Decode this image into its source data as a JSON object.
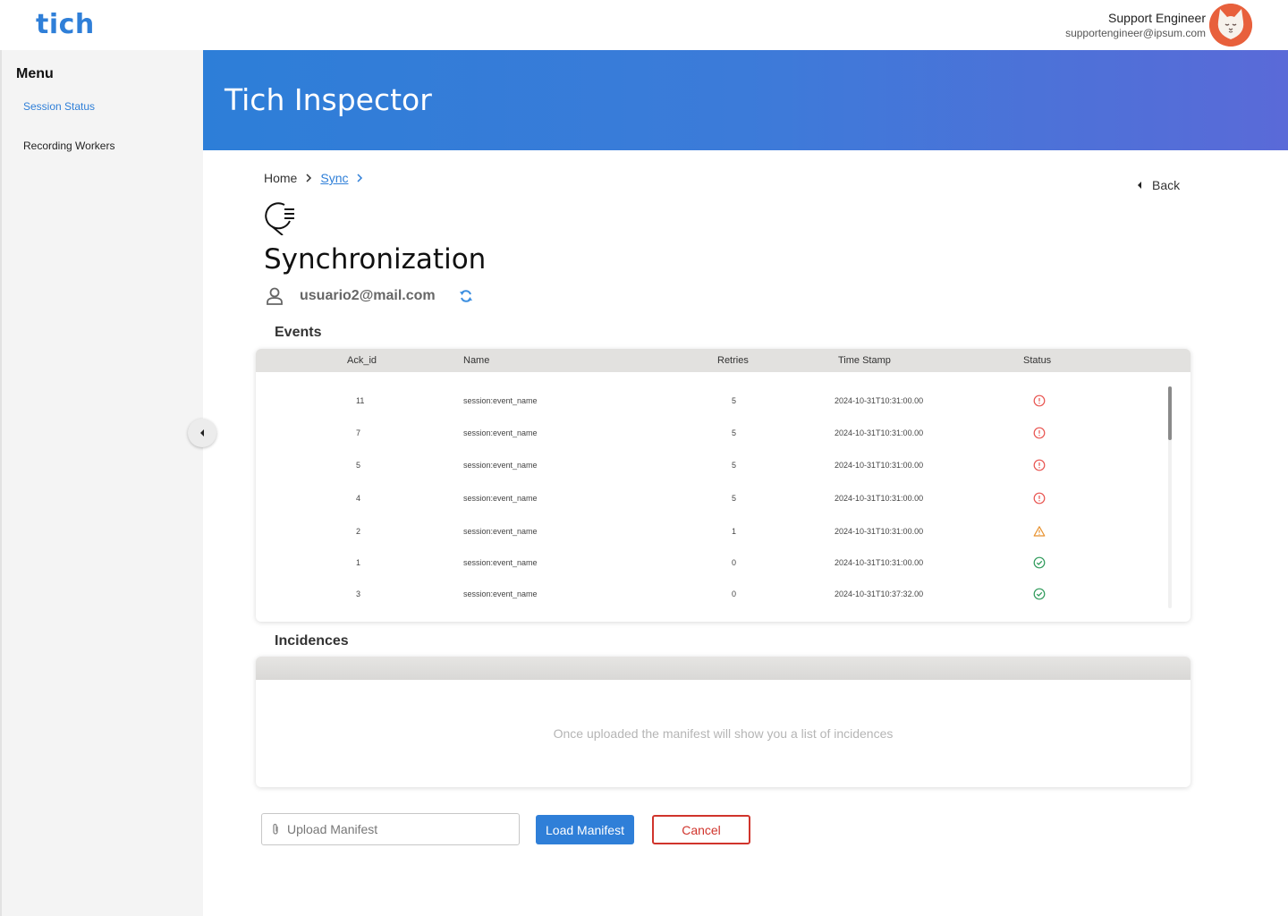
{
  "app": {
    "logo": "tich",
    "banner_title": "Tich Inspector"
  },
  "user": {
    "name": "Support Engineer",
    "email": "supportengineer@ipsum.com",
    "avatar_icon": "cat-avatar-icon"
  },
  "sidebar": {
    "title": "Menu",
    "items": [
      {
        "label": "Session Status",
        "active": true
      },
      {
        "label": "Recording Workers",
        "active": false
      }
    ]
  },
  "breadcrumb": {
    "home": "Home",
    "sync": "Sync"
  },
  "back_label": "Back",
  "page": {
    "title": "Synchronization",
    "user_email": "usuario2@mail.com"
  },
  "events": {
    "title": "Events",
    "columns": [
      "Ack_id",
      "Name",
      "Retries",
      "Time Stamp",
      "Status"
    ],
    "rows": [
      {
        "ack_id": "11",
        "name": "session:event_name",
        "retries": "5",
        "timestamp": "2024-10-31T10:31:00.00",
        "status": "error"
      },
      {
        "ack_id": "7",
        "name": "session:event_name",
        "retries": "5",
        "timestamp": "2024-10-31T10:31:00.00",
        "status": "error"
      },
      {
        "ack_id": "5",
        "name": "session:event_name",
        "retries": "5",
        "timestamp": "2024-10-31T10:31:00.00",
        "status": "error"
      },
      {
        "ack_id": "4",
        "name": "session:event_name",
        "retries": "5",
        "timestamp": "2024-10-31T10:31:00.00",
        "status": "error"
      },
      {
        "ack_id": "2",
        "name": "session:event_name",
        "retries": "1",
        "timestamp": "2024-10-31T10:31:00.00",
        "status": "warning"
      },
      {
        "ack_id": "1",
        "name": "session:event_name",
        "retries": "0",
        "timestamp": "2024-10-31T10:31:00.00",
        "status": "success"
      },
      {
        "ack_id": "3",
        "name": "session:event_name",
        "retries": "0",
        "timestamp": "2024-10-31T10:37:32.00",
        "status": "success"
      }
    ]
  },
  "incidences": {
    "title": "Incidences",
    "empty_message": "Once uploaded the manifest will show you a list of incidences"
  },
  "actions": {
    "upload_placeholder": "Upload Manifest",
    "load_label": "Load Manifest",
    "cancel_label": "Cancel"
  },
  "colors": {
    "accent": "#2f7fd8",
    "error": "#e8534f",
    "warning": "#e8912d",
    "success": "#2e9a5a",
    "cancel": "#d0342c"
  }
}
